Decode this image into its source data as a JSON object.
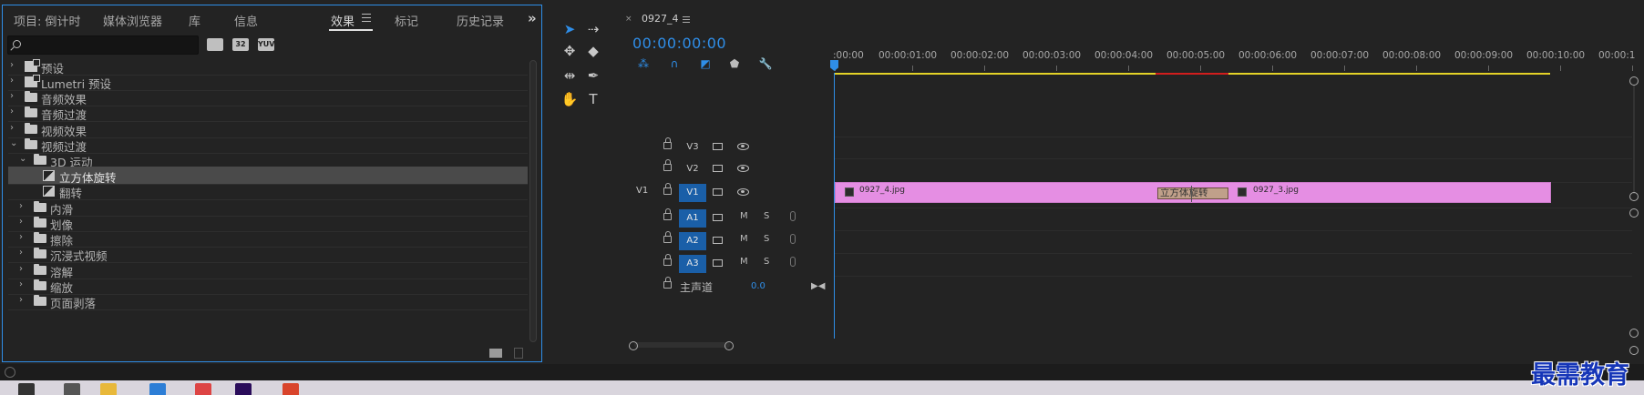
{
  "effects_panel": {
    "tabs": [
      {
        "label": "项目: 倒计时"
      },
      {
        "label": "媒体浏览器"
      },
      {
        "label": "库"
      },
      {
        "label": "信息"
      },
      {
        "label": "效果"
      },
      {
        "label": "标记"
      },
      {
        "label": "历史记录"
      }
    ],
    "active_tab": "效果",
    "overflow_glyph": "»",
    "search": {
      "value": "",
      "placeholder": ""
    },
    "filter_icons": [
      {
        "name": "accelerated-effects-icon",
        "text": ""
      },
      {
        "name": "32bit-color-icon",
        "text": "32"
      },
      {
        "name": "yuv-effects-icon",
        "text": "YUV"
      }
    ],
    "tree": [
      {
        "label": "预设",
        "level": 0,
        "icon": "preset-bin-icon",
        "expanded": false
      },
      {
        "label": "Lumetri 预设",
        "level": 0,
        "icon": "preset-bin-icon",
        "expanded": false
      },
      {
        "label": "音频效果",
        "level": 0,
        "icon": "folder-icon",
        "expanded": false
      },
      {
        "label": "音频过渡",
        "level": 0,
        "icon": "folder-icon",
        "expanded": false
      },
      {
        "label": "视频效果",
        "level": 0,
        "icon": "folder-icon",
        "expanded": false
      },
      {
        "label": "视频过渡",
        "level": 0,
        "icon": "folder-icon",
        "expanded": true
      },
      {
        "label": "3D 运动",
        "level": 1,
        "icon": "folder-icon",
        "expanded": true
      },
      {
        "label": "立方体旋转",
        "level": 2,
        "icon": "transition-icon",
        "selected": true
      },
      {
        "label": "翻转",
        "level": 2,
        "icon": "transition-icon"
      },
      {
        "label": "内滑",
        "level": 1,
        "icon": "folder-icon",
        "expanded": false
      },
      {
        "label": "划像",
        "level": 1,
        "icon": "folder-icon",
        "expanded": false
      },
      {
        "label": "擦除",
        "level": 1,
        "icon": "folder-icon",
        "expanded": false
      },
      {
        "label": "沉浸式视频",
        "level": 1,
        "icon": "folder-icon",
        "expanded": false
      },
      {
        "label": "溶解",
        "level": 1,
        "icon": "folder-icon",
        "expanded": false
      },
      {
        "label": "缩放",
        "level": 1,
        "icon": "folder-icon",
        "expanded": false
      },
      {
        "label": "页面剥落",
        "level": 1,
        "icon": "folder-icon",
        "expanded": false
      }
    ]
  },
  "toolbar": {
    "tools": [
      {
        "name": "selection-tool",
        "glyph": "➤",
        "active": true
      },
      {
        "name": "track-select-tool",
        "glyph": "⇢"
      },
      {
        "name": "ripple-edit-tool",
        "glyph": "✥"
      },
      {
        "name": "razor-tool",
        "glyph": "◆"
      },
      {
        "name": "slip-tool",
        "glyph": "⇹"
      },
      {
        "name": "pen-tool",
        "glyph": "✒"
      },
      {
        "name": "hand-tool",
        "glyph": "✋"
      },
      {
        "name": "type-tool",
        "glyph": "T"
      }
    ]
  },
  "timeline": {
    "sequence_tab": "0927_4",
    "close_glyph": "×",
    "timecode": "00:00:00:00",
    "controls": [
      {
        "name": "nest-toggle-icon",
        "glyph": "⁂",
        "color": "blue"
      },
      {
        "name": "snap-magnet-icon",
        "glyph": "∩",
        "color": "blue"
      },
      {
        "name": "linked-selection-icon",
        "glyph": "◩",
        "color": "blue"
      },
      {
        "name": "add-marker-icon",
        "glyph": "⬟",
        "color": "grey"
      },
      {
        "name": "timeline-settings-wrench-icon",
        "glyph": "🔧",
        "color": "grey"
      }
    ],
    "ruler_labels": [
      ":00:00",
      "00:00:01:00",
      "00:00:02:00",
      "00:00:03:00",
      "00:00:04:00",
      "00:00:05:00",
      "00:00:06:00",
      "00:00:07:00",
      "00:00:08:00",
      "00:00:09:00",
      "00:00:10:00",
      "00:00:1"
    ],
    "video_tracks": [
      {
        "name": "V3",
        "source": "",
        "targeted": false
      },
      {
        "name": "V2",
        "source": "",
        "targeted": false
      },
      {
        "name": "V1",
        "source": "V1",
        "targeted": true
      }
    ],
    "audio_tracks": [
      {
        "name": "A1",
        "mute": "M",
        "solo": "S"
      },
      {
        "name": "A2",
        "mute": "M",
        "solo": "S"
      },
      {
        "name": "A3",
        "mute": "M",
        "solo": "S"
      }
    ],
    "master": {
      "label": "主声道",
      "value": "0.0",
      "end_glyph": "▶◀"
    },
    "clips": [
      {
        "name": "0927_4.jpg"
      },
      {
        "name": "0927_3.jpg"
      }
    ],
    "transition": {
      "name": "立方体旋转"
    },
    "colors": {
      "accent": "#2f8ee8",
      "clip": "#e58ee3",
      "work_area": "#e3d227",
      "render_red": "#d11d1d"
    }
  },
  "watermark": "最需教育"
}
